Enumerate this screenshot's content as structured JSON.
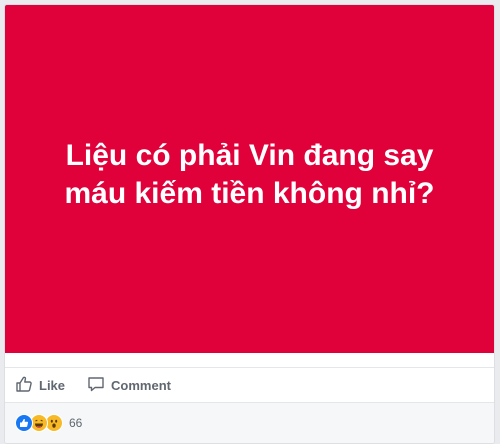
{
  "post": {
    "image_text": "Liệu có phải Vin đang say máu kiếm tiền không nhỉ?",
    "image_color": "#e0003a"
  },
  "actions": {
    "like_label": "Like",
    "comment_label": "Comment"
  },
  "reactions": {
    "icons": [
      "like-icon",
      "haha-icon",
      "wow-icon"
    ],
    "count": "66"
  }
}
